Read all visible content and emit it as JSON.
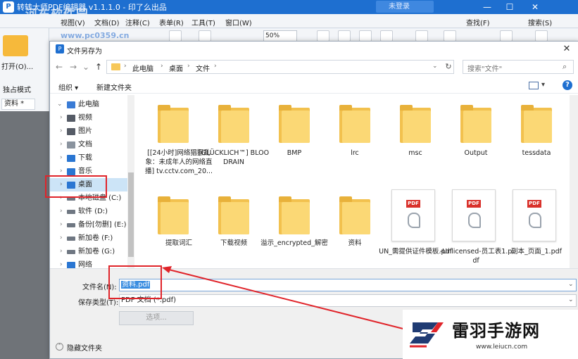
{
  "app": {
    "title": "转转大师PDF编辑器 v1.1.1.0 - 印了么出品",
    "logo_letter": "P",
    "user_label": "未登录",
    "window_controls": [
      "—",
      "☐",
      "✕"
    ],
    "menus": [
      "视图(V)",
      "文档(D)",
      "注释(C)",
      "表单(R)",
      "工具(T)",
      "窗口(W)"
    ],
    "find_label": "查找(F)",
    "search_label": "搜索(S)",
    "zoom_value": "50%",
    "open_label": "打开(O)...",
    "rail_label": "独占模式",
    "doc_tab": "资料 *"
  },
  "watermark": {
    "site_name": "河东软件园",
    "site_url": "www.pc0359.cn"
  },
  "dialog": {
    "title": "文件另存为",
    "close_glyph": "✕",
    "nav": {
      "back": "←",
      "forward": "→",
      "recent": "⌄",
      "up": "↑"
    },
    "breadcrumb": [
      "此电脑",
      "桌面",
      "文件"
    ],
    "search_placeholder": "搜索\"文件\"",
    "organize": "组织 ▾",
    "new_folder": "新建文件夹",
    "help": "?",
    "tree": [
      {
        "label": "此电脑",
        "icon": "pc-icon",
        "color": "#3a7bd5"
      },
      {
        "label": "视频",
        "icon": "video-icon",
        "color": "#555b66"
      },
      {
        "label": "图片",
        "icon": "pictures-icon",
        "color": "#555b66"
      },
      {
        "label": "文档",
        "icon": "documents-icon",
        "color": "#8a939e"
      },
      {
        "label": "下载",
        "icon": "download-icon",
        "color": "#2a76d2"
      },
      {
        "label": "音乐",
        "icon": "music-icon",
        "color": "#2a76d2"
      },
      {
        "label": "桌面",
        "icon": "desktop-icon",
        "color": "#2a76d2"
      },
      {
        "label": "本地磁盘 (C:)",
        "icon": "drive-icon",
        "color": "#6f7782"
      },
      {
        "label": "软件 (D:)",
        "icon": "drive-icon",
        "color": "#6f7782"
      },
      {
        "label": "备份[勿删] (E:)",
        "icon": "drive-icon",
        "color": "#6f7782"
      },
      {
        "label": "新加卷 (F:)",
        "icon": "drive-icon",
        "color": "#6f7782"
      },
      {
        "label": "新加卷 (G:)",
        "icon": "drive-icon",
        "color": "#6f7782"
      },
      {
        "label": "网络",
        "icon": "network-icon",
        "color": "#2a76d2"
      }
    ],
    "selected_tree_item": "桌面",
    "files": [
      {
        "name": "[[24小时]网络猖獗乱象：未成年人的网络直播] tv.cctv.com_20...",
        "type": "folder"
      },
      {
        "name": "[GLÜCKLICH™] BLOODRAIN",
        "type": "folder"
      },
      {
        "name": "BMP",
        "type": "folder"
      },
      {
        "name": "lrc",
        "type": "folder"
      },
      {
        "name": "msc",
        "type": "folder"
      },
      {
        "name": "Output",
        "type": "folder"
      },
      {
        "name": "tessdata",
        "type": "folder"
      },
      {
        "name": "提取词汇",
        "type": "folder"
      },
      {
        "name": "下载视频",
        "type": "folder"
      },
      {
        "name": "溢示_encrypted_解密",
        "type": "folder"
      },
      {
        "name": "资料",
        "type": "folder"
      },
      {
        "name": "UN_需提供证件模板.pdf",
        "type": "pdf"
      },
      {
        "name": "-Unlicensed-员工表1.pdf",
        "type": "pdf"
      },
      {
        "name": "副本_页面_1.pdf",
        "type": "pdf"
      }
    ],
    "pdf_badge": "PDF",
    "filename_label": "文件名(N):",
    "filename_value": "资料.pdf",
    "filetype_label": "保存类型(T):",
    "filetype_value": "PDF 文档 (*.pdf)",
    "options_button": "选项...",
    "hide_folders": "隐藏文件夹"
  },
  "annotation_color": "#e0242a",
  "brand": {
    "name": "雷羽手游网",
    "url": "www.leiucn.com",
    "accent": "#e0242a",
    "dark": "#1f3b73"
  }
}
